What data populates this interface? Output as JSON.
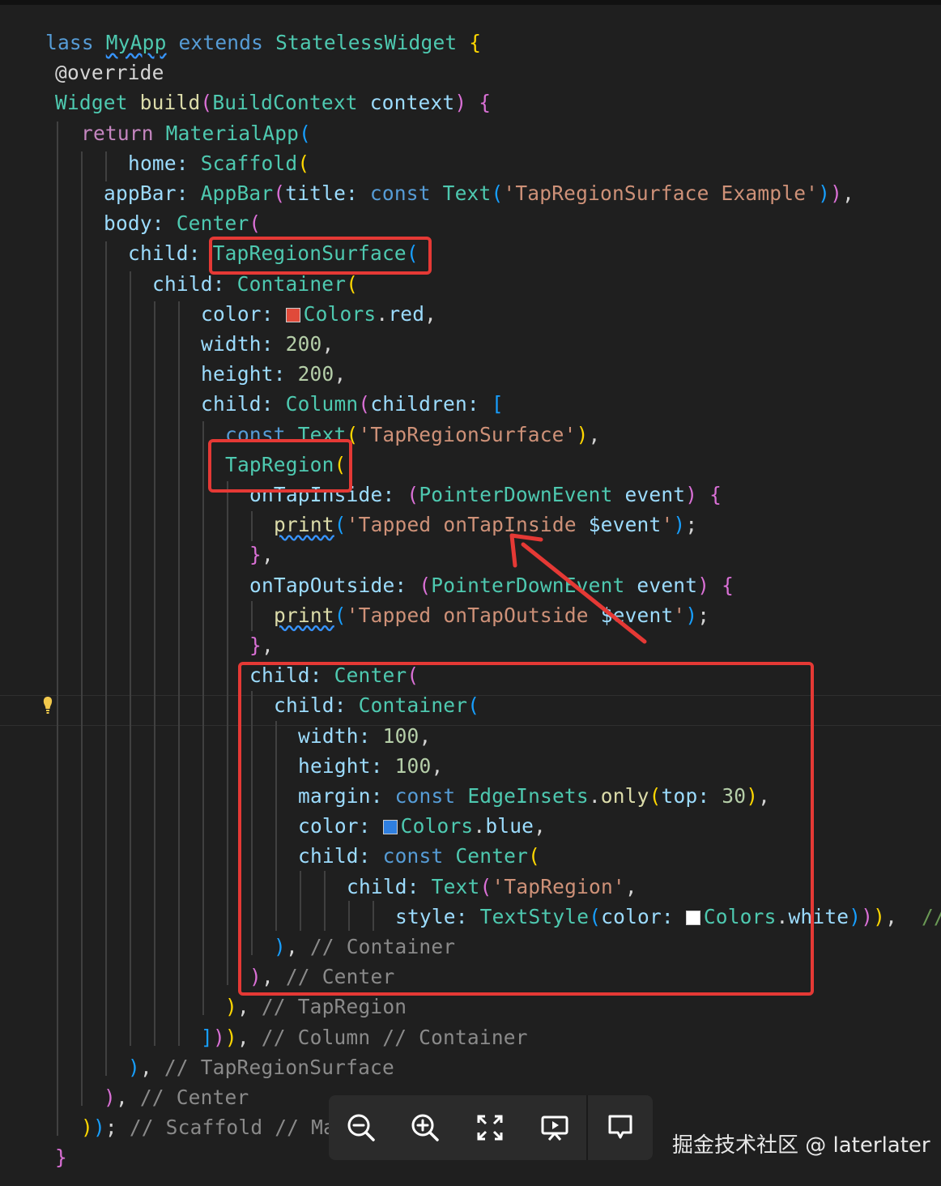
{
  "editor": {
    "lines": [
      {
        "indent": 56,
        "tokens": [
          [
            "kw",
            "lass "
          ],
          [
            "cls sq",
            "MyApp"
          ],
          [
            "kw",
            " extends "
          ],
          [
            "cls",
            "StatelessWidget"
          ],
          [
            "p1",
            " {"
          ]
        ]
      },
      {
        "indent": 68,
        "tokens": [
          [
            "txt",
            "@override"
          ]
        ]
      },
      {
        "indent": 68,
        "tokens": [
          [
            "cls",
            "Widget"
          ],
          [
            "fn",
            " build"
          ],
          [
            "p2",
            "("
          ],
          [
            "cls",
            "BuildContext"
          ],
          [
            "prop",
            " context"
          ],
          [
            "p2",
            ")"
          ],
          [
            "p2",
            " {"
          ]
        ]
      },
      {
        "indent": 100,
        "tokens": [
          [
            "ctl",
            "return "
          ],
          [
            "cls",
            "MaterialApp"
          ],
          [
            "p3",
            "("
          ]
        ]
      },
      {
        "indent": 158,
        "tokens": [
          [
            "prop",
            "home: "
          ],
          [
            "cls",
            "Scaffold"
          ],
          [
            "p1",
            "("
          ]
        ]
      },
      {
        "indent": 128,
        "tokens": [
          [
            "prop",
            "appBar: "
          ],
          [
            "cls",
            "AppBar"
          ],
          [
            "p2",
            "("
          ],
          [
            "prop",
            "title: "
          ],
          [
            "kw",
            "const "
          ],
          [
            "cls",
            "Text"
          ],
          [
            "p3",
            "("
          ],
          [
            "str",
            "'TapRegionSurface Example'"
          ],
          [
            "p3",
            ")"
          ],
          [
            "p2",
            ")"
          ],
          [
            "txt",
            ","
          ]
        ]
      },
      {
        "indent": 128,
        "tokens": [
          [
            "prop",
            "body: "
          ],
          [
            "cls",
            "Center"
          ],
          [
            "p2",
            "("
          ]
        ]
      },
      {
        "indent": 158,
        "tokens": [
          [
            "prop",
            "child: "
          ],
          [
            "cls",
            "TapRegionSurface"
          ],
          [
            "p3",
            "("
          ]
        ]
      },
      {
        "indent": 188,
        "tokens": [
          [
            "prop",
            "child: "
          ],
          [
            "cls",
            "Container"
          ],
          [
            "p1",
            "("
          ]
        ]
      },
      {
        "indent": 248,
        "tokens": [
          [
            "prop",
            "color: "
          ],
          [
            "swatch",
            "#e04a3a"
          ],
          [
            "cls",
            "Colors"
          ],
          [
            "txt",
            "."
          ],
          [
            "prop",
            "red"
          ],
          [
            "txt",
            ","
          ]
        ]
      },
      {
        "indent": 248,
        "tokens": [
          [
            "prop",
            "width: "
          ],
          [
            "num",
            "200"
          ],
          [
            "txt",
            ","
          ]
        ]
      },
      {
        "indent": 248,
        "tokens": [
          [
            "prop",
            "height: "
          ],
          [
            "num",
            "200"
          ],
          [
            "txt",
            ","
          ]
        ]
      },
      {
        "indent": 248,
        "tokens": [
          [
            "prop",
            "child: "
          ],
          [
            "cls",
            "Column"
          ],
          [
            "p2",
            "("
          ],
          [
            "prop",
            "children: "
          ],
          [
            "p3",
            "["
          ]
        ]
      },
      {
        "indent": 278,
        "tokens": [
          [
            "kw",
            "const "
          ],
          [
            "cls",
            "Text"
          ],
          [
            "p1",
            "("
          ],
          [
            "str",
            "'TapRegionSurface'"
          ],
          [
            "p1",
            ")"
          ],
          [
            "txt",
            ","
          ]
        ]
      },
      {
        "indent": 278,
        "tokens": [
          [
            "cls",
            "TapRegion"
          ],
          [
            "p1",
            "("
          ]
        ]
      },
      {
        "indent": 308,
        "tokens": [
          [
            "prop",
            "onTapInside: "
          ],
          [
            "p2",
            "("
          ],
          [
            "cls",
            "PointerDownEvent"
          ],
          [
            "prop",
            " event"
          ],
          [
            "p2",
            ")"
          ],
          [
            "p2",
            " {"
          ]
        ]
      },
      {
        "indent": 338,
        "tokens": [
          [
            "fn sq",
            "print"
          ],
          [
            "p3",
            "("
          ],
          [
            "str",
            "'Tapped onTapInside "
          ],
          [
            "prop",
            "$event"
          ],
          [
            "str",
            "'"
          ],
          [
            "p3",
            ")"
          ],
          [
            "txt",
            ";"
          ]
        ]
      },
      {
        "indent": 308,
        "tokens": [
          [
            "p2",
            "}"
          ],
          [
            "txt",
            ","
          ]
        ]
      },
      {
        "indent": 308,
        "tokens": [
          [
            "prop",
            "onTapOutside: "
          ],
          [
            "p2",
            "("
          ],
          [
            "cls",
            "PointerDownEvent"
          ],
          [
            "prop",
            " event"
          ],
          [
            "p2",
            ")"
          ],
          [
            "p2",
            " {"
          ]
        ]
      },
      {
        "indent": 338,
        "tokens": [
          [
            "fn sq",
            "print"
          ],
          [
            "p3",
            "("
          ],
          [
            "str",
            "'Tapped onTapOutside "
          ],
          [
            "prop",
            "$event"
          ],
          [
            "str",
            "'"
          ],
          [
            "p3",
            ")"
          ],
          [
            "txt",
            ";"
          ]
        ]
      },
      {
        "indent": 308,
        "tokens": [
          [
            "p2",
            "}"
          ],
          [
            "txt",
            ","
          ]
        ]
      },
      {
        "indent": 308,
        "tokens": [
          [
            "prop",
            "child: "
          ],
          [
            "cls",
            "Center"
          ],
          [
            "p2",
            "("
          ]
        ]
      },
      {
        "indent": 338,
        "tokens": [
          [
            "prop",
            "child: "
          ],
          [
            "cls",
            "Container"
          ],
          [
            "p3",
            "("
          ]
        ]
      },
      {
        "indent": 368,
        "tokens": [
          [
            "prop",
            "width: "
          ],
          [
            "num",
            "100"
          ],
          [
            "txt",
            ","
          ]
        ]
      },
      {
        "indent": 368,
        "tokens": [
          [
            "prop",
            "height: "
          ],
          [
            "num",
            "100"
          ],
          [
            "txt",
            ","
          ]
        ]
      },
      {
        "indent": 368,
        "tokens": [
          [
            "prop",
            "margin: "
          ],
          [
            "kw",
            "const "
          ],
          [
            "cls",
            "EdgeInsets"
          ],
          [
            "txt",
            "."
          ],
          [
            "fn",
            "only"
          ],
          [
            "p1",
            "("
          ],
          [
            "prop",
            "top: "
          ],
          [
            "num",
            "30"
          ],
          [
            "p1",
            ")"
          ],
          [
            "txt",
            ","
          ]
        ]
      },
      {
        "indent": 368,
        "tokens": [
          [
            "prop",
            "color: "
          ],
          [
            "swatch",
            "#2f7fe0"
          ],
          [
            "cls",
            "Colors"
          ],
          [
            "txt",
            "."
          ],
          [
            "prop",
            "blue"
          ],
          [
            "txt",
            ","
          ]
        ]
      },
      {
        "indent": 368,
        "tokens": [
          [
            "prop",
            "child: "
          ],
          [
            "kw",
            "const "
          ],
          [
            "cls",
            "Center"
          ],
          [
            "p1",
            "("
          ]
        ]
      },
      {
        "indent": 428,
        "tokens": [
          [
            "prop",
            "child: "
          ],
          [
            "cls",
            "Text"
          ],
          [
            "p2",
            "("
          ],
          [
            "str",
            "'TapRegion'"
          ],
          [
            "txt",
            ","
          ]
        ]
      },
      {
        "indent": 488,
        "tokens": [
          [
            "prop",
            "style: "
          ],
          [
            "cls",
            "TextStyle"
          ],
          [
            "p3",
            "("
          ],
          [
            "prop",
            "color: "
          ],
          [
            "swatch",
            "#ffffff"
          ],
          [
            "cls",
            "Colors"
          ],
          [
            "txt",
            "."
          ],
          [
            "prop",
            "white"
          ],
          [
            "p3",
            ")"
          ],
          [
            "p2",
            ")"
          ],
          [
            "p1",
            ")"
          ],
          [
            "txt",
            ",  "
          ],
          [
            "cmt",
            "//"
          ]
        ]
      },
      {
        "indent": 338,
        "tokens": [
          [
            "p3",
            ")"
          ],
          [
            "txt",
            ", "
          ],
          [
            "cmt2",
            "// Container"
          ]
        ]
      },
      {
        "indent": 308,
        "tokens": [
          [
            "p2",
            ")"
          ],
          [
            "txt",
            ", "
          ],
          [
            "cmt2",
            "// Center"
          ]
        ]
      },
      {
        "indent": 278,
        "tokens": [
          [
            "p1",
            ")"
          ],
          [
            "txt",
            ", "
          ],
          [
            "cmt2",
            "// TapRegion"
          ]
        ]
      },
      {
        "indent": 248,
        "tokens": [
          [
            "p3",
            "]"
          ],
          [
            "p2",
            ")"
          ],
          [
            "p1",
            ")"
          ],
          [
            "txt",
            ", "
          ],
          [
            "cmt2",
            "// Column // Container"
          ]
        ]
      },
      {
        "indent": 158,
        "tokens": [
          [
            "p3",
            ")"
          ],
          [
            "txt",
            ", "
          ],
          [
            "cmt2",
            "// TapRegionSurface"
          ]
        ]
      },
      {
        "indent": 128,
        "tokens": [
          [
            "p2",
            ")"
          ],
          [
            "txt",
            ", "
          ],
          [
            "cmt2",
            "// Center"
          ]
        ]
      },
      {
        "indent": 100,
        "tokens": [
          [
            "p1",
            ")"
          ],
          [
            "p3",
            ")"
          ],
          [
            "txt",
            "; "
          ],
          [
            "cmt2",
            "// Scaffold // Ma"
          ]
        ]
      },
      {
        "indent": 68,
        "tokens": [
          [
            "p2",
            "}"
          ]
        ]
      }
    ]
  },
  "icons": {
    "zoom_out": "zoom-out-icon",
    "zoom_in": "zoom-in-icon",
    "fullscreen": "fullscreen-icon",
    "slideshow": "slideshow-icon",
    "comment": "comment-icon",
    "lightbulb": "lightbulb-icon"
  },
  "watermark": {
    "text": "掘金技术社区 @ laterlater"
  },
  "colors": {
    "background": "#1f1f1f",
    "highlight_box": "#e53935",
    "arrow": "#e53935",
    "toolbar": "#2b2b2b"
  }
}
